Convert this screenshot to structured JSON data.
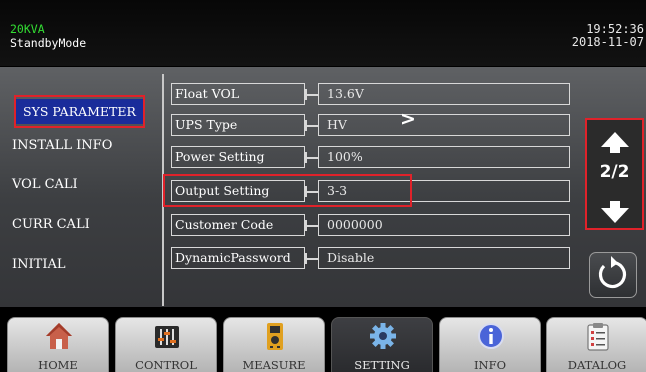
{
  "header": {
    "model": "20KVA",
    "mode": "StandbyMode",
    "time": "19:52:36",
    "date": "2018-11-07"
  },
  "sidebar": {
    "items": [
      {
        "label": "SYS PARAMETER",
        "selected": true
      },
      {
        "label": "INSTALL INFO"
      },
      {
        "label": "VOL CALI"
      },
      {
        "label": "CURR CALI"
      },
      {
        "label": "INITIAL"
      }
    ]
  },
  "settings": [
    {
      "label": "Float VOL",
      "value": "13.6V"
    },
    {
      "label": "UPS Type",
      "value": "HV"
    },
    {
      "label": "Power Setting",
      "value": "100%"
    },
    {
      "label": "Output Setting",
      "value": "3-3"
    },
    {
      "label": "Customer Code",
      "value": "0000000"
    },
    {
      "label": "DynamicPassword",
      "value": "Disable"
    }
  ],
  "pager": {
    "page": "2/2"
  },
  "nav": {
    "tabs": [
      {
        "label": "HOME",
        "icon": "home-icon"
      },
      {
        "label": "CONTROL",
        "icon": "sliders-icon"
      },
      {
        "label": "MEASURE",
        "icon": "multimeter-icon"
      },
      {
        "label": "SETTING",
        "icon": "gear-icon",
        "active": true
      },
      {
        "label": "INFO",
        "icon": "info-icon"
      },
      {
        "label": "DATALOG",
        "icon": "clipboard-icon"
      }
    ]
  },
  "colors": {
    "highlight_red": "#e0222a",
    "selected_blue": "#1a2c9a",
    "model_green": "#33dd33"
  }
}
